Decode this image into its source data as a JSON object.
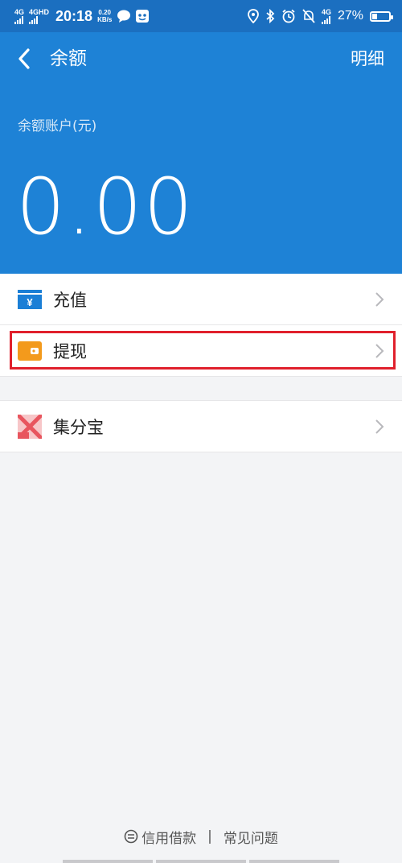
{
  "status_bar": {
    "sim1": "4G",
    "sim2": "4GHD",
    "time": "20:18",
    "speed_value": "0.20",
    "speed_unit": "KB/s",
    "net": "4G",
    "battery_percent": "27%",
    "battery_level": 0.27
  },
  "header": {
    "title": "余额",
    "detail_label": "明细",
    "account_label": "余额账户(元)",
    "balance": "0.00"
  },
  "menu": {
    "recharge": "充值",
    "withdraw": "提现",
    "jifenbao": "集分宝"
  },
  "footer": {
    "credit_loan": "信用借款",
    "separator": "|",
    "faq": "常见问题"
  },
  "colors": {
    "header_bg": "#1e82d6",
    "highlight": "#e0202c",
    "recharge_icon": "#1b7fd6",
    "withdraw_icon": "#f39a1c",
    "jifenbao_icon": "#e8555e"
  }
}
